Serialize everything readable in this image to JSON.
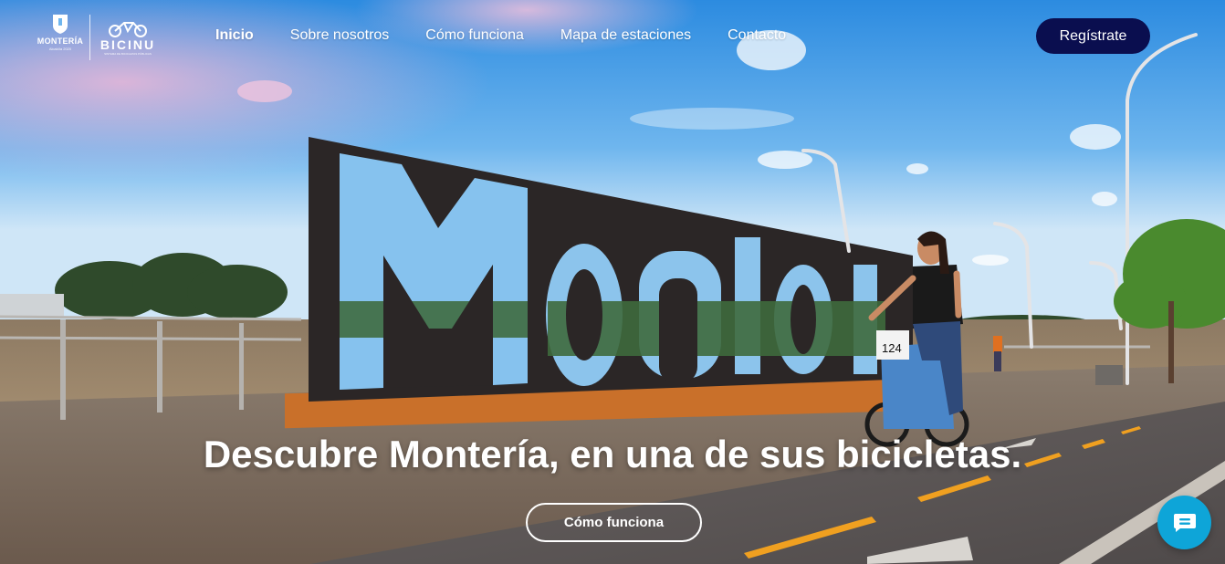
{
  "header": {
    "city_logo": {
      "name": "MONTERÍA",
      "subtitle": "Alcaldía 2020"
    },
    "brand_logo": {
      "name": "BICINU",
      "tagline": "SISTEMA DE BICICLETAS PÚBLICAS"
    },
    "nav": [
      {
        "label": "Inicio",
        "active": true
      },
      {
        "label": "Sobre nosotros",
        "active": false
      },
      {
        "label": "Cómo funciona",
        "active": false
      },
      {
        "label": "Mapa de estaciones",
        "active": false
      },
      {
        "label": "Contacto",
        "active": false
      }
    ],
    "register_label": "Regístrate"
  },
  "hero": {
    "sign_text": "Montería",
    "bike_plate": "124",
    "headline": "Descubre Montería, en una de sus bicicletas.",
    "cta_label": "Cómo funciona"
  },
  "chat": {
    "icon": "chat-bubble-icon"
  },
  "colors": {
    "register_bg": "#0a0e4f",
    "chat_bg": "#0ea5d8",
    "sky_top": "#2f8fe0",
    "sky_low": "#cfe6f7",
    "sign_dark": "#2b2626",
    "sign_base": "#c9702a",
    "lane_marking": "#f0a020"
  }
}
